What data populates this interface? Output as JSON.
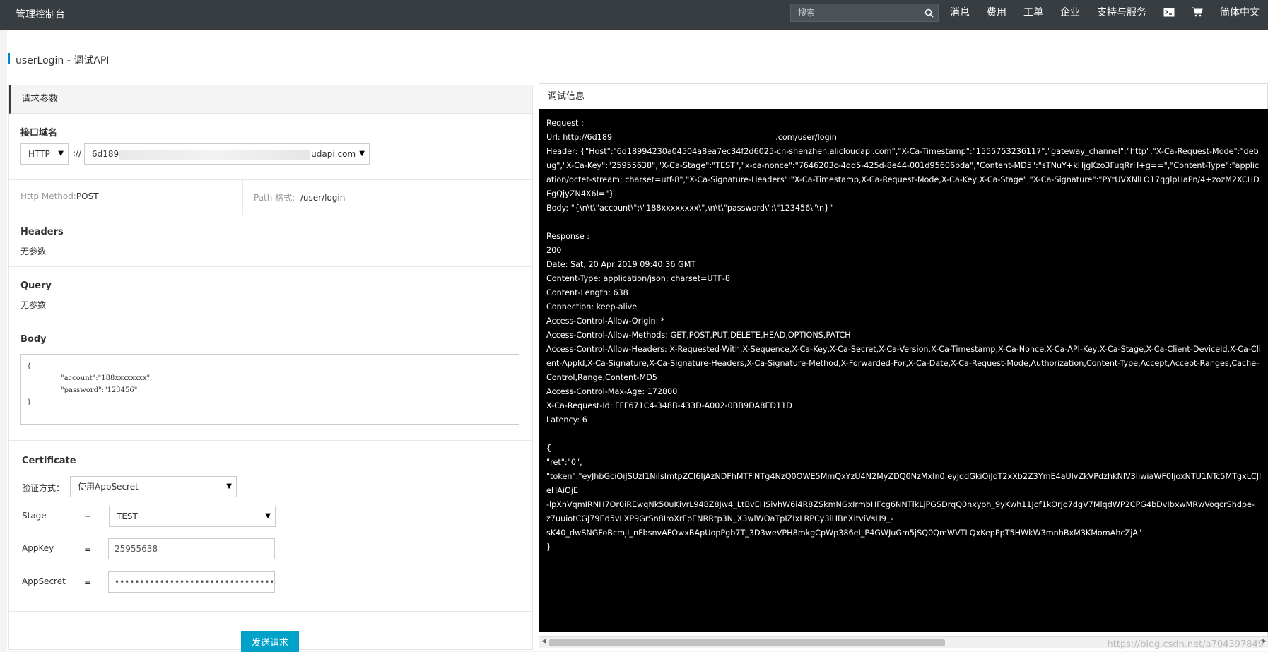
{
  "topbar": {
    "brand": "管理控制台",
    "search_placeholder": "搜索",
    "nav": [
      "消息",
      "费用",
      "工单",
      "企业",
      "支持与服务"
    ],
    "lang": "简体中文"
  },
  "page": {
    "title": "userLogin - 调试API"
  },
  "request_panel": {
    "header": "请求参数",
    "domain_label": "接口域名",
    "protocol": "HTTP",
    "sep": "://",
    "domain_prefix": "6d189",
    "domain_suffix": "udapi.com",
    "http_method_label": "Http Method:",
    "http_method": "POST",
    "path_label": "Path 格式:",
    "path": "/user/login",
    "headers_label": "Headers",
    "headers_value": "无参数",
    "query_label": "Query",
    "query_value": "无参数",
    "body_label": "Body",
    "body_lines": [
      "{",
      "\"account\":\"188xxxxxxxx\",",
      "\"password\":\"123456\"",
      "}"
    ],
    "certificate_label": "Certificate",
    "verify_label": "验证方式：",
    "verify_value": "使用AppSecret",
    "stage_label": "Stage",
    "stage_value": "TEST",
    "appkey_label": "AppKey",
    "appkey_value": "25955638",
    "appsecret_label": "AppSecret",
    "appsecret_value": "••••••••••••••••••••••••••••••••",
    "equals": "=",
    "send_button": "发送请求"
  },
  "debug_panel": {
    "header": "调试信息",
    "lines": [
      "Request :",
      "Url: http://6d189                                                                 .com/user/login",
      "Header: {\"Host\":\"6d18994230a04504a8ea7ec34f2d6025-cn-shenzhen.alicloudapi.com\",\"X-Ca-Timestamp\":\"1555753236117\",\"gateway_channel\":\"http\",\"X-Ca-Request-Mode\":\"debug\",\"X-Ca-Key\":\"25955638\",\"X-Ca-Stage\":\"TEST\",\"x-ca-nonce\":\"7646203c-4dd5-425d-8e44-001d95606bda\",\"Content-MD5\":\"sTNuY+kHjgKzo3FuqRrH+g==\",\"Content-Type\":\"application/octet-stream; charset=utf-8\",\"X-Ca-Signature-Headers\":\"X-Ca-Timestamp,X-Ca-Request-Mode,X-Ca-Key,X-Ca-Stage\",\"X-Ca-Signature\":\"PYtUVXNlLO17qglpHaPn/4+zozM2XCHDEgQjyZN4X6I=\"}",
      "Body: \"{\\n\\t\\\"account\\\":\\\"188xxxxxxxx\\\",\\n\\t\\\"password\\\":\\\"123456\\\"\\n}\"",
      "",
      "Response :",
      "200",
      "Date: Sat, 20 Apr 2019 09:40:36 GMT",
      "Content-Type: application/json; charset=UTF-8",
      "Content-Length: 638",
      "Connection: keep-alive",
      "Access-Control-Allow-Origin: *",
      "Access-Control-Allow-Methods: GET,POST,PUT,DELETE,HEAD,OPTIONS,PATCH",
      "Access-Control-Allow-Headers: X-Requested-With,X-Sequence,X-Ca-Key,X-Ca-Secret,X-Ca-Version,X-Ca-Timestamp,X-Ca-Nonce,X-Ca-API-Key,X-Ca-Stage,X-Ca-Client-DeviceId,X-Ca-Client-AppId,X-Ca-Signature,X-Ca-Signature-Headers,X-Ca-Signature-Method,X-Forwarded-For,X-Ca-Date,X-Ca-Request-Mode,Authorization,Content-Type,Accept,Accept-Ranges,Cache-Control,Range,Content-MD5",
      "Access-Control-Max-Age: 172800",
      "X-Ca-Request-Id: FFF671C4-348B-433D-A002-0BB9DA8ED11D",
      "Latency: 6",
      "",
      "{",
      "\"ret\":\"0\",",
      "\"token\":\"eyJhbGciOiJSUzI1NiIsImtpZCI6IjAzNDFhMTFiNTg4NzQ0OWE5MmQxYzU4N2MyZDQ0NzMxIn0.eyJqdGkiOiJoT2xXb2Z3YmE4aUlvZkVPdzhkNlV3IiwiaWF0IjoxNTU1NTc5MTgxLCJleHAiOjE",
      "-lpXnVqmIRNH7Or0iREwqNk50uKivrL948Z8Jw4_LtBvEHSivhW6i4R8ZSkmNGxIrmbHFcg6NNTlkLjPGSDrqQ0nxyoh_9yKwh11Jof1kOrJo7dgV7MlqdWP2CPG4bDvIbxwMRwVoqcrShdpe-",
      "z7uuiotCGJ79Ed5vLXP9GrSn8IroXrFpENRRtp3N_X3wlWOaTpIZIxLRPCy3iHBnXItviVsH9_-",
      "sK40_dwSNGFoBcmjI_nFbsnvAFOwxBApUopPgb7T_3D3weVPH8mkgCpWp386eI_P4GWJuGm5jSQ0QmWVTLQxKepPpT5HWkW3mnhBxM3KMomAhcZjA\"",
      "}"
    ]
  },
  "watermark": "https://blog.csdn.net/a704397849"
}
